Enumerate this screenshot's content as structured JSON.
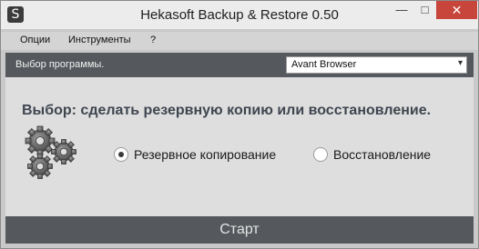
{
  "window": {
    "title": "Hekasoft Backup & Restore 0.50",
    "app_icon_glyph": "S",
    "minimize_glyph": "—",
    "maximize_glyph": "□",
    "close_glyph": "✕"
  },
  "menu": {
    "items": [
      {
        "label": "Опции"
      },
      {
        "label": "Инструменты"
      },
      {
        "label": "?"
      }
    ]
  },
  "program_bar": {
    "label": "Выбор программы.",
    "selected_program": "Avant Browser",
    "arrow_glyph": "▾"
  },
  "main": {
    "heading": "Выбор: сделать резервную копию или восстановление.",
    "icon": "gears-icon",
    "options": [
      {
        "label": "Резервное копирование",
        "selected": true
      },
      {
        "label": "Восстановление",
        "selected": false
      }
    ]
  },
  "footer": {
    "start_label": "Старт"
  },
  "colors": {
    "dark_bar": "#55585d",
    "close_button": "#c7453a",
    "heading": "#3f4650"
  }
}
